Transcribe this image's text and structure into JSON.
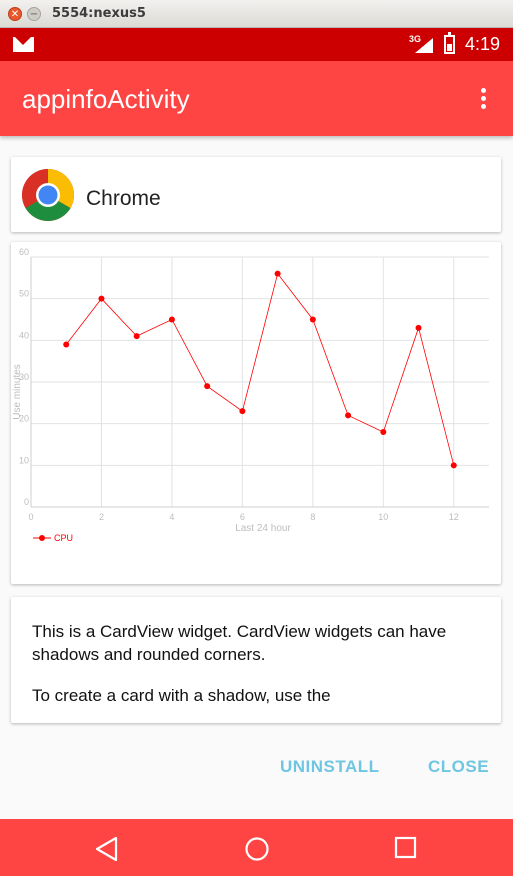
{
  "window": {
    "title": "5554:nexus5"
  },
  "status_bar": {
    "network": "3G",
    "time": "4:19"
  },
  "app_bar": {
    "title": "appinfoActivity"
  },
  "app_card": {
    "name": "Chrome"
  },
  "chart_data": {
    "type": "line",
    "x": [
      1,
      2,
      3,
      4,
      5,
      6,
      7,
      8,
      9,
      10,
      11,
      12
    ],
    "series": [
      {
        "name": "CPU",
        "values": [
          39,
          50,
          41,
          45,
          29,
          23,
          56,
          45,
          22,
          18,
          43,
          10
        ],
        "color": "#ff0000"
      }
    ],
    "xlabel": "Last 24 hour",
    "ylabel": "Use minutes",
    "xlim": [
      0,
      13
    ],
    "ylim": [
      0,
      60
    ],
    "xticks": [
      0,
      2,
      4,
      6,
      8,
      10,
      12
    ],
    "yticks": [
      0,
      10,
      20,
      30,
      40,
      50,
      60
    ],
    "grid": true,
    "legend_position": "bottom-left"
  },
  "text_card": {
    "paragraph1": "This is a CardView widget. CardView widgets can have shadows and rounded corners.",
    "paragraph2": "To create a card with a shadow, use the"
  },
  "actions": {
    "uninstall": "UNINSTALL",
    "close": "CLOSE"
  },
  "colors": {
    "status_bar": "#cc0000",
    "app_bar": "#ff4444",
    "accent_button": "#6ec6e3",
    "series": "#ff0000"
  }
}
